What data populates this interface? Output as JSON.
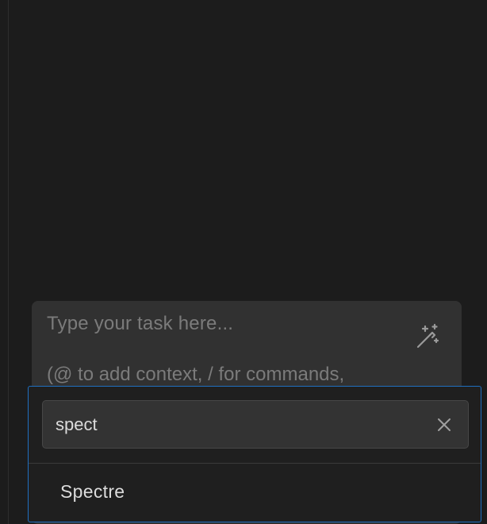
{
  "task_input": {
    "placeholder": "Type your task here...",
    "hint": "(@ to add context, / for commands,"
  },
  "icons": {
    "enhance": "magic-wand-icon",
    "clear": "close-icon"
  },
  "dropdown": {
    "search_value": "spect",
    "results": [
      {
        "label": "Spectre"
      }
    ]
  },
  "colors": {
    "background": "#1c1c1c",
    "input_background": "#313131",
    "focus_border": "#1f6fc0",
    "placeholder_text": "#7b7b7b",
    "text": "#dcdcdc"
  }
}
